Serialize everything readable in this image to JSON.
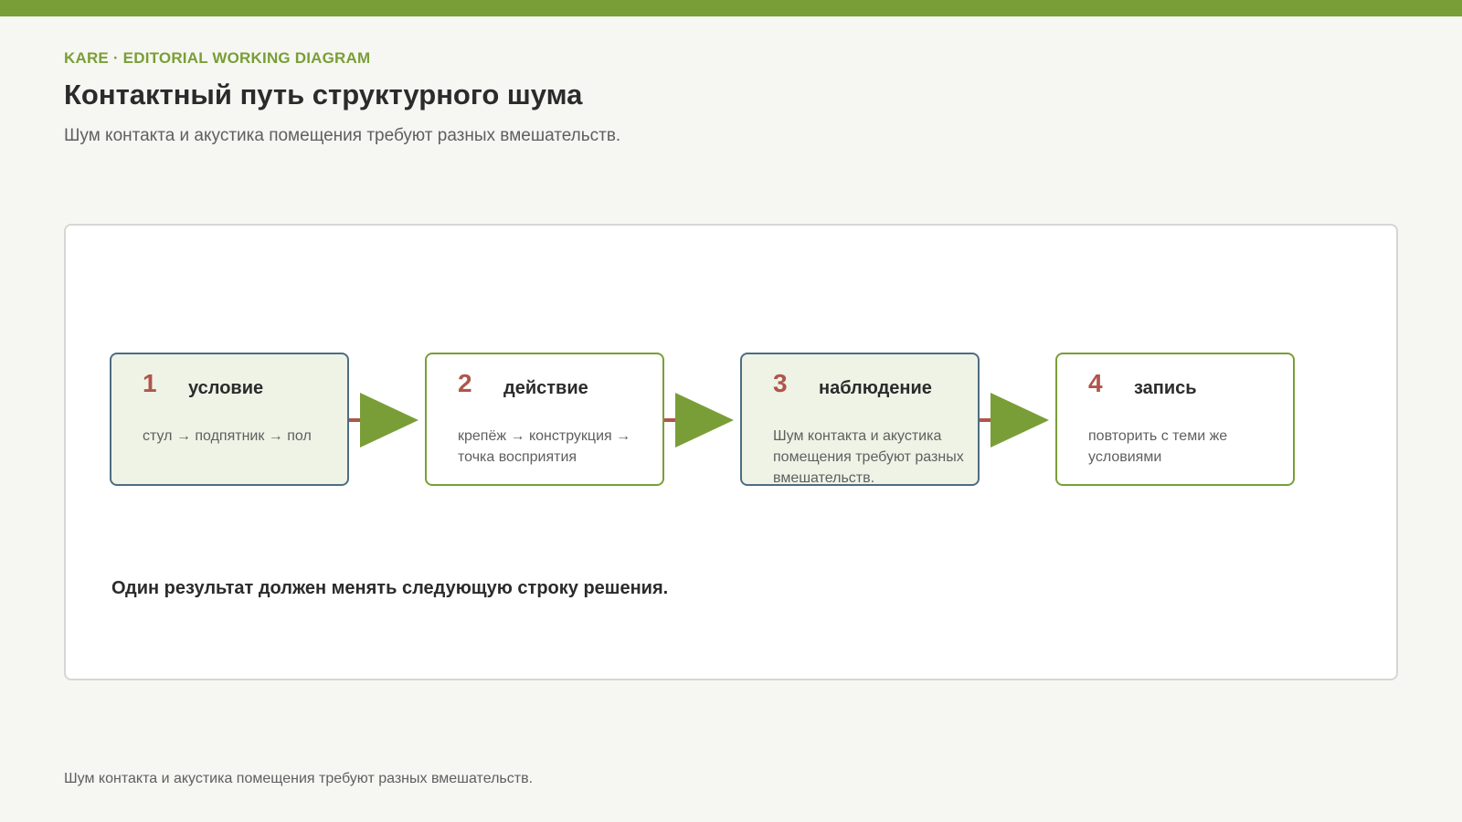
{
  "header": {
    "eyebrow": "KARE · EDITORIAL WORKING DIAGRAM",
    "title": "Контактный путь структурного шума",
    "subtitle": "Шум контакта и акустика помещения требуют разных вмешательств."
  },
  "diagram": {
    "steps": [
      {
        "number": "1",
        "label": "условие",
        "description": "стул → подпятник → пол"
      },
      {
        "number": "2",
        "label": "действие",
        "description": "крепёж → конструкция → точка восприятия"
      },
      {
        "number": "3",
        "label": "наблюдение",
        "description": "Шум контакта и акустика помещения требуют разных вмешательств."
      },
      {
        "number": "4",
        "label": "запись",
        "description": "повторить с теми же условиями"
      }
    ],
    "takeaway": "Один результат должен менять следующую строку решения."
  },
  "footer": {
    "note": "Шум контакта и акустика помещения требуют разных вмешательств."
  },
  "colors": {
    "accent": "#7a9e37",
    "number": "#b0554a",
    "shaded_fill": "#eef3e6",
    "shaded_border": "#4d6d82",
    "arrow_stem": "#b0554a"
  },
  "icons": [
    "arrow-right-icon"
  ]
}
